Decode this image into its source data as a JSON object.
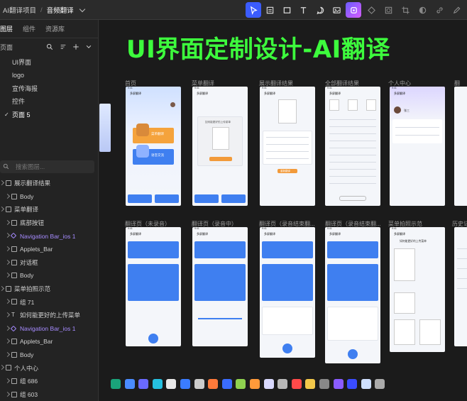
{
  "breadcrumb": {
    "project": "AI翻译项目",
    "separator": "/",
    "file": "音频翻译"
  },
  "sidebar": {
    "tabs": [
      {
        "label": "图层",
        "active": true
      },
      {
        "label": "组件"
      },
      {
        "label": "资源库"
      }
    ],
    "pages_header": "页面",
    "pages": [
      {
        "label": "UI界面"
      },
      {
        "label": "logo"
      },
      {
        "label": "宣传海报"
      },
      {
        "label": "控件"
      },
      {
        "label": "页面 5",
        "selected": true
      }
    ],
    "search_placeholder": "搜索图层...",
    "layers": [
      {
        "label": "展示翻译结果",
        "level": 0
      },
      {
        "label": "Body",
        "level": 1
      },
      {
        "label": "菜单翻译",
        "level": 0
      },
      {
        "label": "底部按钮",
        "level": 1
      },
      {
        "label": "Navigation Bar_ios 1",
        "level": 1,
        "component": true
      },
      {
        "label": "Applets_Bar",
        "level": 1
      },
      {
        "label": "对话框",
        "level": 1
      },
      {
        "label": "Body",
        "level": 1
      },
      {
        "label": "菜单拍照示范",
        "level": 0
      },
      {
        "label": "组 71",
        "level": 1
      },
      {
        "label": "如何能更好的上传菜单",
        "level": 1,
        "text": true
      },
      {
        "label": "Navigation Bar_ios 1",
        "level": 1,
        "component": true
      },
      {
        "label": "Applets_Bar",
        "level": 1
      },
      {
        "label": "Body",
        "level": 1
      },
      {
        "label": "个人中心",
        "level": 0
      },
      {
        "label": "组 686",
        "level": 1
      },
      {
        "label": "组 603",
        "level": 1
      }
    ]
  },
  "canvas": {
    "headline": "UI界面定制设计-AI翻译",
    "row1_labels": [
      "首页",
      "菜单翻译",
      "展示翻译结果",
      "全部翻译结果",
      "个人中心",
      "翻"
    ],
    "row2_labels": [
      "翻译页（未录音）",
      "翻译页（录音中）",
      "翻译页（录音结束翻...",
      "翻译页（录音结束翻...",
      "菜单拍照示范",
      "历史记"
    ],
    "frame_title": "多屏翻译",
    "frame_time": "9:41",
    "home_card1": "菜单翻译",
    "home_card2": "语音交流",
    "menu_hint": "如何能更好的上传菜单",
    "result_btn": "重新翻译",
    "profile_name": "张三"
  },
  "colors": {
    "accent": "#3b5cff",
    "headline": "#3dfc3d",
    "blue": "#3f7ff0",
    "orange": "#f29a3a"
  }
}
